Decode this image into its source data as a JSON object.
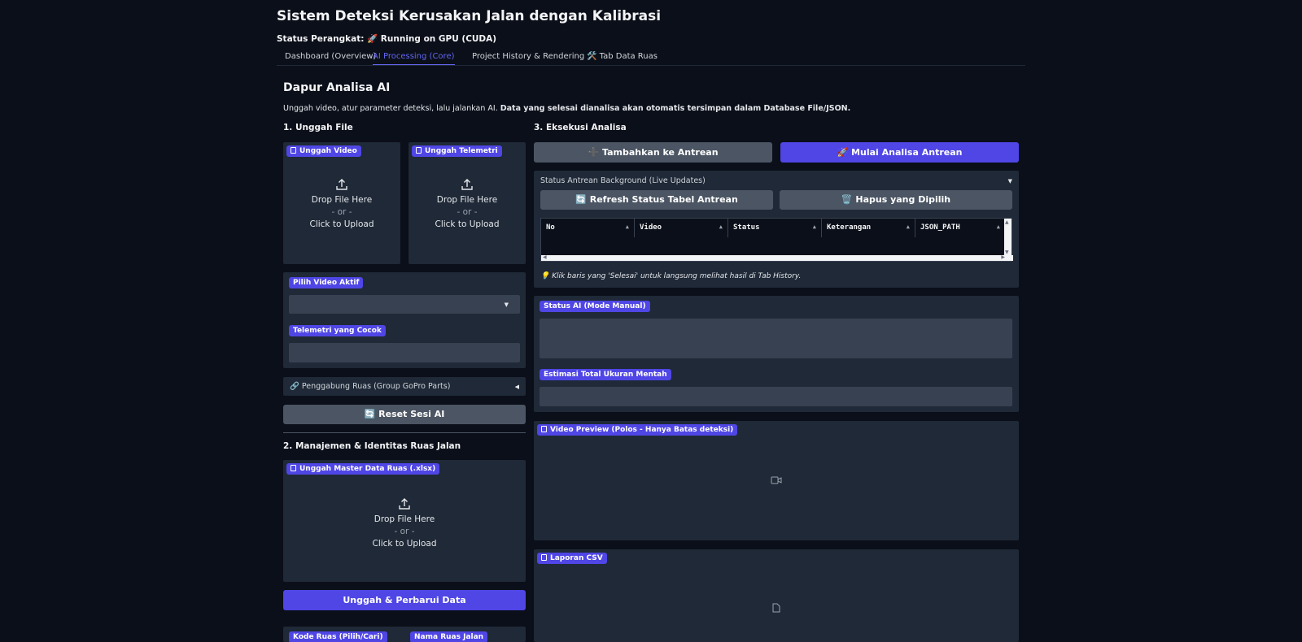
{
  "app": {
    "title": "Sistem Deteksi Kerusakan Jalan dengan Kalibrasi",
    "device_status": "Status Perangkat: 🚀 Running on GPU (CUDA)"
  },
  "tabs": [
    {
      "label": "Dashboard (Overview)"
    },
    {
      "label": "AI Processing (Core)"
    },
    {
      "label": "Project History & Rendering"
    },
    {
      "label": "🛠️ Tab Data Ruas"
    }
  ],
  "main": {
    "title": "Dapur Analisa AI",
    "desc_plain": "Unggah video, atur parameter deteksi, lalu jalankan AI. ",
    "desc_bold": "Data yang selesai dianalisa akan otomatis tersimpan dalam Database File/JSON."
  },
  "upload_section": {
    "heading": "1. Unggah File",
    "video_label": "Unggah Video",
    "telemetry_label": "Unggah Telemetri",
    "drop_text": "Drop File Here",
    "or_text": "- or -",
    "click_text": "Click to Upload"
  },
  "active_video": {
    "label": "Pilih Video Aktif",
    "value": "",
    "telemetry_label": "Telemetri yang Cocok",
    "telemetry_value": ""
  },
  "merge_accordion": {
    "label": "🔗 Penggabung Ruas (Group GoPro Parts)"
  },
  "reset_button": {
    "label": "🔄 Reset Sesi AI"
  },
  "management": {
    "heading": "2. Manajemen & Identitas Ruas Jalan",
    "master_label": "Unggah Master Data Ruas (.xlsx)",
    "upload_button": "Unggah & Perbarui Data",
    "kode_label": "Kode Ruas (Pilih/Cari)",
    "nama_label": "Nama Ruas Jalan"
  },
  "execution": {
    "heading": "3. Eksekusi Analisa",
    "add_queue": "➕ Tambahkan ke Antrean",
    "start_queue": "🚀 Mulai Analisa Antrean"
  },
  "queue_accordion": {
    "label": "Status Antrean Background (Live Updates)",
    "refresh": "🔄 Refresh Status Tabel Antrean",
    "delete": "🗑️ Hapus yang Dipilih",
    "columns": [
      "No",
      "Video",
      "Status",
      "Keterangan",
      "JSON_PATH"
    ],
    "hint": "💡 Klik baris yang 'Selesai' untuk langsung melihat hasil di Tab History."
  },
  "status_ai": {
    "label": "Status AI (Mode Manual)",
    "value": "",
    "size_label": "Estimasi Total Ukuran Mentah",
    "size_value": ""
  },
  "video_preview": {
    "label": "Video Preview (Polos - Hanya Batas deteksi)"
  },
  "csv_report": {
    "label": "Laporan CSV"
  },
  "colors": {
    "background": "#0b0f19",
    "panel": "#1f2937",
    "accent": "#4f46e5",
    "button_gray": "#4b5563"
  }
}
